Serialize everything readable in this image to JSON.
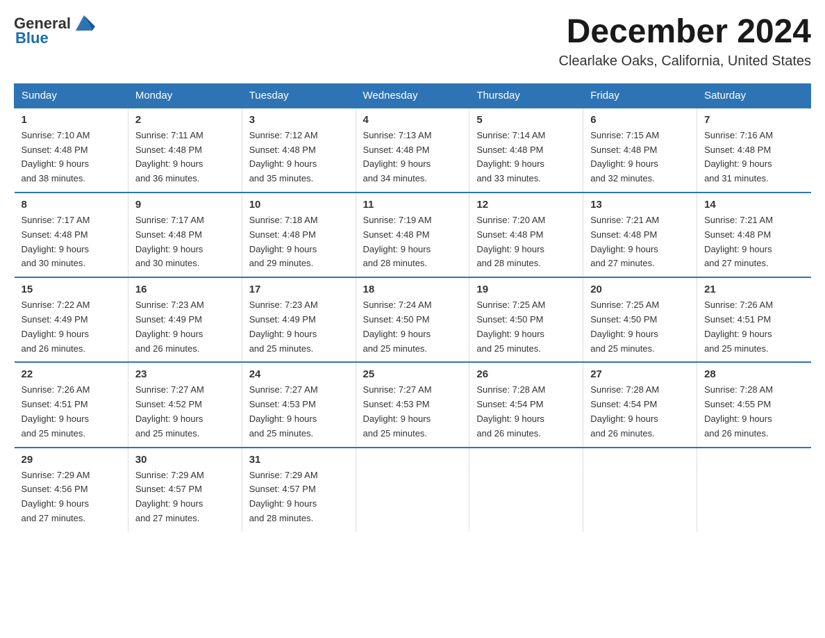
{
  "header": {
    "logo_general": "General",
    "logo_blue": "Blue",
    "month_title": "December 2024",
    "location": "Clearlake Oaks, California, United States"
  },
  "days_of_week": [
    "Sunday",
    "Monday",
    "Tuesday",
    "Wednesday",
    "Thursday",
    "Friday",
    "Saturday"
  ],
  "weeks": [
    [
      {
        "num": "1",
        "sunrise": "7:10 AM",
        "sunset": "4:48 PM",
        "daylight": "9 hours and 38 minutes."
      },
      {
        "num": "2",
        "sunrise": "7:11 AM",
        "sunset": "4:48 PM",
        "daylight": "9 hours and 36 minutes."
      },
      {
        "num": "3",
        "sunrise": "7:12 AM",
        "sunset": "4:48 PM",
        "daylight": "9 hours and 35 minutes."
      },
      {
        "num": "4",
        "sunrise": "7:13 AM",
        "sunset": "4:48 PM",
        "daylight": "9 hours and 34 minutes."
      },
      {
        "num": "5",
        "sunrise": "7:14 AM",
        "sunset": "4:48 PM",
        "daylight": "9 hours and 33 minutes."
      },
      {
        "num": "6",
        "sunrise": "7:15 AM",
        "sunset": "4:48 PM",
        "daylight": "9 hours and 32 minutes."
      },
      {
        "num": "7",
        "sunrise": "7:16 AM",
        "sunset": "4:48 PM",
        "daylight": "9 hours and 31 minutes."
      }
    ],
    [
      {
        "num": "8",
        "sunrise": "7:17 AM",
        "sunset": "4:48 PM",
        "daylight": "9 hours and 30 minutes."
      },
      {
        "num": "9",
        "sunrise": "7:17 AM",
        "sunset": "4:48 PM",
        "daylight": "9 hours and 30 minutes."
      },
      {
        "num": "10",
        "sunrise": "7:18 AM",
        "sunset": "4:48 PM",
        "daylight": "9 hours and 29 minutes."
      },
      {
        "num": "11",
        "sunrise": "7:19 AM",
        "sunset": "4:48 PM",
        "daylight": "9 hours and 28 minutes."
      },
      {
        "num": "12",
        "sunrise": "7:20 AM",
        "sunset": "4:48 PM",
        "daylight": "9 hours and 28 minutes."
      },
      {
        "num": "13",
        "sunrise": "7:21 AM",
        "sunset": "4:48 PM",
        "daylight": "9 hours and 27 minutes."
      },
      {
        "num": "14",
        "sunrise": "7:21 AM",
        "sunset": "4:48 PM",
        "daylight": "9 hours and 27 minutes."
      }
    ],
    [
      {
        "num": "15",
        "sunrise": "7:22 AM",
        "sunset": "4:49 PM",
        "daylight": "9 hours and 26 minutes."
      },
      {
        "num": "16",
        "sunrise": "7:23 AM",
        "sunset": "4:49 PM",
        "daylight": "9 hours and 26 minutes."
      },
      {
        "num": "17",
        "sunrise": "7:23 AM",
        "sunset": "4:49 PM",
        "daylight": "9 hours and 25 minutes."
      },
      {
        "num": "18",
        "sunrise": "7:24 AM",
        "sunset": "4:50 PM",
        "daylight": "9 hours and 25 minutes."
      },
      {
        "num": "19",
        "sunrise": "7:25 AM",
        "sunset": "4:50 PM",
        "daylight": "9 hours and 25 minutes."
      },
      {
        "num": "20",
        "sunrise": "7:25 AM",
        "sunset": "4:50 PM",
        "daylight": "9 hours and 25 minutes."
      },
      {
        "num": "21",
        "sunrise": "7:26 AM",
        "sunset": "4:51 PM",
        "daylight": "9 hours and 25 minutes."
      }
    ],
    [
      {
        "num": "22",
        "sunrise": "7:26 AM",
        "sunset": "4:51 PM",
        "daylight": "9 hours and 25 minutes."
      },
      {
        "num": "23",
        "sunrise": "7:27 AM",
        "sunset": "4:52 PM",
        "daylight": "9 hours and 25 minutes."
      },
      {
        "num": "24",
        "sunrise": "7:27 AM",
        "sunset": "4:53 PM",
        "daylight": "9 hours and 25 minutes."
      },
      {
        "num": "25",
        "sunrise": "7:27 AM",
        "sunset": "4:53 PM",
        "daylight": "9 hours and 25 minutes."
      },
      {
        "num": "26",
        "sunrise": "7:28 AM",
        "sunset": "4:54 PM",
        "daylight": "9 hours and 26 minutes."
      },
      {
        "num": "27",
        "sunrise": "7:28 AM",
        "sunset": "4:54 PM",
        "daylight": "9 hours and 26 minutes."
      },
      {
        "num": "28",
        "sunrise": "7:28 AM",
        "sunset": "4:55 PM",
        "daylight": "9 hours and 26 minutes."
      }
    ],
    [
      {
        "num": "29",
        "sunrise": "7:29 AM",
        "sunset": "4:56 PM",
        "daylight": "9 hours and 27 minutes."
      },
      {
        "num": "30",
        "sunrise": "7:29 AM",
        "sunset": "4:57 PM",
        "daylight": "9 hours and 27 minutes."
      },
      {
        "num": "31",
        "sunrise": "7:29 AM",
        "sunset": "4:57 PM",
        "daylight": "9 hours and 28 minutes."
      },
      null,
      null,
      null,
      null
    ]
  ],
  "labels": {
    "sunrise": "Sunrise:",
    "sunset": "Sunset:",
    "daylight": "Daylight:"
  },
  "accent_color": "#2e74b5"
}
